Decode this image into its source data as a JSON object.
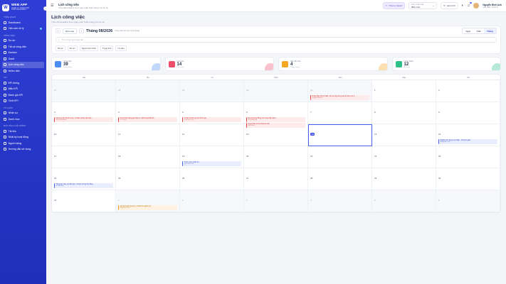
{
  "sidebar": {
    "brand": "WEB APP",
    "brand_sub": "QUẢN LÝ TỔNG HỢP",
    "brand_sub2": "CHẤT NHÂN BẢN",
    "sections": [
      {
        "title": "TỔNG QUAN",
        "items": [
          {
            "label": "Dashboard",
            "icon": "dashboard-icon"
          },
          {
            "label": "Việc cần xử lý",
            "icon": "inbox-icon",
            "badge": "5"
          }
        ]
      },
      {
        "title": "CÔNG VIỆC",
        "items": [
          {
            "label": "Dự án",
            "icon": "folder-icon"
          },
          {
            "label": "Tất cả công việc",
            "icon": "list-icon"
          },
          {
            "label": "Kanban",
            "icon": "kanban-icon"
          },
          {
            "label": "Gantt",
            "icon": "gantt-icon"
          },
          {
            "label": "Lịch công việc",
            "icon": "calendar-icon",
            "active": true
          },
          {
            "label": "Nhiều việc",
            "icon": "stack-icon"
          }
        ]
      },
      {
        "title": "KPI",
        "items": [
          {
            "label": "KPI thống",
            "icon": "target-icon"
          },
          {
            "label": "Mẫu KPI",
            "icon": "template-icon"
          },
          {
            "label": "Đánh giá KPI",
            "icon": "star-icon"
          },
          {
            "label": "Chốt KPI",
            "icon": "check-icon"
          }
        ]
      },
      {
        "title": "TỔ CHỨC",
        "items": [
          {
            "label": "Nhân sự",
            "icon": "users-icon"
          },
          {
            "label": "Danh mục",
            "icon": "grid-icon"
          }
        ]
      },
      {
        "title": "BÁO CÁO & HỆ THỐNG",
        "items": [
          {
            "label": "Tài liệu",
            "icon": "doc-icon"
          },
          {
            "label": "Nhật ký hoạt động",
            "icon": "log-icon"
          },
          {
            "label": "Người dùng",
            "icon": "user-icon"
          },
          {
            "label": "Hướng dẫn sử dụng",
            "icon": "help-icon"
          }
        ]
      }
    ]
  },
  "topbar": {
    "title": "Lịch công việc",
    "subtitle": "Theo dõi deadline theo ngày, tuần hoặc tháng cho dự án",
    "theme_btn": "Theme classic",
    "dept_label": "Đơn vị làm việc",
    "dept_value": "Bản mục",
    "refresh": "Làm mới",
    "notif": "3",
    "user_name": "Nguyễn Đình Anh",
    "user_role": "Giám đốc / Quản trị"
  },
  "page": {
    "title": "Lịch công việc",
    "subtitle": "Theo dõi deadline theo ngày, tuần hoặc tháng cho dự án"
  },
  "toolbar": {
    "today": "Hôm nay",
    "month_title": "Tháng 08/2026",
    "month_sub": "Tổng quan lịch việc trong tháng",
    "views": [
      "Ngày",
      "Tuần",
      "Tháng"
    ],
    "active_view": "Tháng",
    "search_placeholder": "Tìm công việc theo tên...",
    "filters": [
      "Bộ lọc",
      "Dự án",
      "Người phụ trách",
      "Trạng thái",
      "Ưu tiên"
    ]
  },
  "stats": [
    {
      "label": "Công việc",
      "value": "39",
      "hint": "Trong tháng",
      "color": "#4c8df6"
    },
    {
      "label": "Quá hạn",
      "value": "14",
      "hint": "Cần xử lý",
      "color": "#ef4d6a"
    },
    {
      "label": "Sắp đến hạn",
      "value": "4",
      "hint": "Trong 3 ngày",
      "color": "#f5a623"
    },
    {
      "label": "Hoàn thành",
      "value": "12",
      "hint": "Đã xong",
      "color": "#2fc08a"
    }
  ],
  "calendar": {
    "weekdays": [
      "Hai",
      "Ba",
      "Tư",
      "Năm",
      "Sáu",
      "Bảy",
      "CN"
    ],
    "days": [
      {
        "d": "27",
        "out": true
      },
      {
        "d": "28",
        "out": true
      },
      {
        "d": "29",
        "out": true
      },
      {
        "d": "30",
        "out": true
      },
      {
        "d": "31",
        "out": true,
        "events": [
          {
            "t": "Hoàn thiện hồ sơ thầu - Dự án xây dựng cao ốc khu vực A",
            "s": "Nguyễn Văn Bảo",
            "c": "r"
          }
        ]
      },
      {
        "d": "1"
      },
      {
        "d": "2"
      },
      {
        "d": "3",
        "events": [
          {
            "t": "Kiểm tra tiến độ thi công - Chuẩn bị báo cáo tuần",
            "s": "Trần Minh Hoàng",
            "c": "r"
          }
        ]
      },
      {
        "d": "4",
        "events": [
          {
            "t": "Họp khách hàng giai đoạn 2 - Đánh giá thiết kế",
            "s": "Lê Thu Hà",
            "c": "r"
          }
        ]
      },
      {
        "d": "5",
        "events": [
          {
            "t": "Chuẩn bị báo cáo tài chính quý",
            "s": "Phạm Đức Long",
            "c": "r"
          }
        ]
      },
      {
        "d": "6",
        "events": [
          {
            "t": "Rà soát hợp đồng nhà cung cấp vật tư",
            "s": "Vũ Quang Huy",
            "c": "r"
          },
          {
            "t": "Duyệt bản vẽ kỹ thuật kết cấu",
            "s": "Đỗ Thị Mai",
            "c": "r"
          }
        ]
      },
      {
        "d": "7"
      },
      {
        "d": "8"
      },
      {
        "d": "9"
      },
      {
        "d": "10"
      },
      {
        "d": "11"
      },
      {
        "d": "12"
      },
      {
        "d": "13"
      },
      {
        "d": "14",
        "today": true
      },
      {
        "d": "15"
      },
      {
        "d": "16",
        "events": [
          {
            "t": "Nghiệm thu hạng mục điện - Chuyển giao",
            "s": "Hoàng Anh Tuấn",
            "c": "b"
          }
        ]
      },
      {
        "d": "17"
      },
      {
        "d": "18"
      },
      {
        "d": "19",
        "events": [
          {
            "t": "Tuyển dụng nhân sự",
            "s": "Ngô Thanh Tâm",
            "c": "b"
          }
        ]
      },
      {
        "d": "20"
      },
      {
        "d": "21"
      },
      {
        "d": "22"
      },
      {
        "d": "23"
      },
      {
        "d": "24",
        "events": [
          {
            "t": "Tổng hợp báo cáo kết quả - Chuẩn bị họp hội đồng",
            "s": "Bùi Văn Nam",
            "c": "b"
          }
        ]
      },
      {
        "d": "25"
      },
      {
        "d": "26"
      },
      {
        "d": "27"
      },
      {
        "d": "28"
      },
      {
        "d": "29"
      },
      {
        "d": "30"
      },
      {
        "d": "31"
      },
      {
        "d": "1",
        "out": true,
        "events": [
          {
            "t": "Lập kế hoạch tháng 9 - Phân bổ nguồn lực",
            "s": "Đặng Minh Châu",
            "c": "o"
          }
        ]
      },
      {
        "d": "2",
        "out": true
      },
      {
        "d": "3",
        "out": true
      },
      {
        "d": "4",
        "out": true
      },
      {
        "d": "5",
        "out": true
      },
      {
        "d": "6",
        "out": true
      }
    ]
  }
}
